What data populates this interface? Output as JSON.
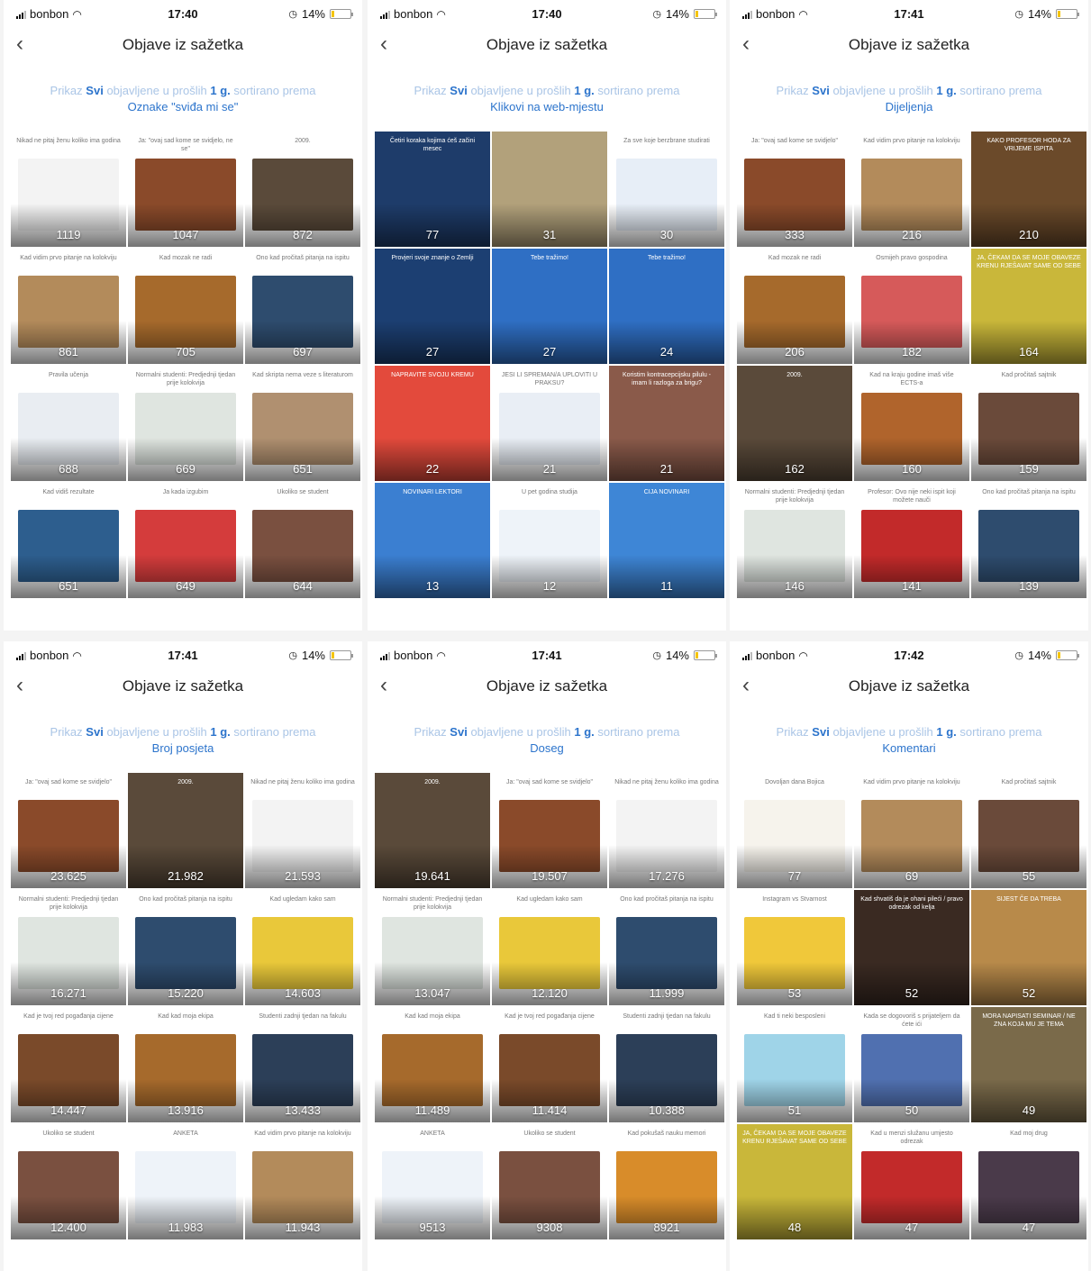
{
  "common": {
    "carrier": "bonbon",
    "battery": "14%",
    "title": "Objave iz sažetka",
    "back_icon": "chevron-left-icon",
    "subtitle_prefix": "Prikaz",
    "subtitle_type": "Svi",
    "subtitle_mid": "objavljene u prošlih",
    "subtitle_period": "1 g.",
    "subtitle_suffix": "sortirano prema"
  },
  "panels": [
    {
      "time": "17:40",
      "metric": "Oznake \"sviđa mi se\"",
      "tiles": [
        {
          "count": "1119",
          "color": "#f3f3f3",
          "caption": "Nikad ne pitaj ženu koliko ima godina"
        },
        {
          "count": "1047",
          "color": "#8a4a2a",
          "caption": "Ja: \"ovaj sad kome se svidjelo, ne se\""
        },
        {
          "count": "872",
          "color": "#5a4a3a",
          "caption": "2009."
        },
        {
          "count": "861",
          "color": "#b38b5b",
          "caption": "Kad vidim prvo pitanje na kolokviju"
        },
        {
          "count": "705",
          "color": "#a66a2c",
          "caption": "Kad mozak ne radi"
        },
        {
          "count": "697",
          "color": "#2e4c6e",
          "caption": "Ono kad pročitaš pitanja na ispitu"
        },
        {
          "count": "688",
          "color": "#e9edf2",
          "caption": "Pravila učenja"
        },
        {
          "count": "669",
          "color": "#dfe5e0",
          "caption": "Normalni studenti: Predjednji tjedan prije kolokvija"
        },
        {
          "count": "651",
          "color": "#b09070",
          "caption": "Kad skripta nema veze s literaturom"
        },
        {
          "count": "651",
          "color": "#2d5e8e",
          "caption": "Kad vidiš rezultate"
        },
        {
          "count": "649",
          "color": "#d43c3c",
          "caption": "Ja kada izgubim"
        },
        {
          "count": "644",
          "color": "#7a5040",
          "caption": "Ukoliko se student"
        }
      ]
    },
    {
      "time": "17:40",
      "metric": "Klikovi na web-mjestu",
      "tiles": [
        {
          "count": "77",
          "color": "#1e3c6a",
          "caption": "Četiri koraka kojima ćeš začini mesec",
          "full": true
        },
        {
          "count": "31",
          "color": "#b2a17b",
          "caption": "",
          "full": true
        },
        {
          "count": "30",
          "color": "#e7eef7",
          "caption": "Za sve koje berzbrane studirati"
        },
        {
          "count": "27",
          "color": "#1c3f72",
          "caption": "Provjeri svoje znanje o Zemlji",
          "full": true
        },
        {
          "count": "27",
          "color": "#2f6fc4",
          "caption": "Tebe tražimo!",
          "full": true
        },
        {
          "count": "24",
          "color": "#2f6fc4",
          "caption": "Tebe tražimo!",
          "full": true
        },
        {
          "count": "22",
          "color": "#e34a3c",
          "caption": "NAPRAVITE SVOJU KREMU",
          "full": true
        },
        {
          "count": "21",
          "color": "#e9eef5",
          "caption": "JESI LI SPREMAN/A UPLOVITI U PRAKSU?"
        },
        {
          "count": "21",
          "color": "#8a5a4a",
          "caption": "Koristim kontracepcijsku pilulu - imam li razloga za brigu?",
          "full": true
        },
        {
          "count": "13",
          "color": "#3b7fd1",
          "caption": "NOVINARI LEKTORI",
          "full": true
        },
        {
          "count": "12",
          "color": "#eef3f9",
          "caption": "U pet godina studija"
        },
        {
          "count": "11",
          "color": "#3e86d6",
          "caption": "CIJA NOVINARI",
          "full": true
        }
      ]
    },
    {
      "time": "17:41",
      "metric": "Dijeljenja",
      "tiles": [
        {
          "count": "333",
          "color": "#8a4a2a",
          "caption": "Ja: \"ovaj sad kome se svidjelo\""
        },
        {
          "count": "216",
          "color": "#b38b5b",
          "caption": "Kad vidim prvo pitanje na kolokviju"
        },
        {
          "count": "210",
          "color": "#6b4a2a",
          "caption": "KAKO PROFESOR HODA ZA VRIJEME ISPITA",
          "full": true
        },
        {
          "count": "206",
          "color": "#a66a2c",
          "caption": "Kad mozak ne radi"
        },
        {
          "count": "182",
          "color": "#d65a5a",
          "caption": "Osmijeh pravo gospodina"
        },
        {
          "count": "164",
          "color": "#c9b73a",
          "caption": "JA, ČEKAM DA SE MOJE OBAVEZE KRENU RJEŠAVAT SAME OD SEBE",
          "full": true
        },
        {
          "count": "162",
          "color": "#5a4a3a",
          "caption": "2009.",
          "full": true
        },
        {
          "count": "160",
          "color": "#b0642c",
          "caption": "Kad na kraju godine imaš više ECTS-a"
        },
        {
          "count": "159",
          "color": "#6a4a3a",
          "caption": "Kad pročitaš sajtnik"
        },
        {
          "count": "146",
          "color": "#dfe5e0",
          "caption": "Normalni studenti: Predjednji tjedan prije kolokvija"
        },
        {
          "count": "141",
          "color": "#c22a2a",
          "caption": "Profesor: Ovo nije neki ispit koji možete nauči"
        },
        {
          "count": "139",
          "color": "#2e4c6e",
          "caption": "Ono kad pročitaš pitanja na ispitu"
        }
      ]
    },
    {
      "time": "17:41",
      "metric": "Broj posjeta",
      "tiles": [
        {
          "count": "23.625",
          "color": "#8a4a2a",
          "caption": "Ja: \"ovaj sad kome se svidjelo\""
        },
        {
          "count": "21.982",
          "color": "#5a4a3a",
          "caption": "2009.",
          "full": true
        },
        {
          "count": "21.593",
          "color": "#f3f3f3",
          "caption": "Nikad ne pitaj ženu koliko ima godina"
        },
        {
          "count": "16.271",
          "color": "#dfe5e0",
          "caption": "Normalni studenti: Predjednji tjedan prije kolokvija"
        },
        {
          "count": "15.220",
          "color": "#2e4c6e",
          "caption": "Ono kad pročitaš pitanja na ispitu"
        },
        {
          "count": "14.603",
          "color": "#e9c83a",
          "caption": "Kad ugledam kako sam"
        },
        {
          "count": "14.447",
          "color": "#7a4a2a",
          "caption": "Kad je tvoj red pogađanja cijene"
        },
        {
          "count": "13.916",
          "color": "#a66a2c",
          "caption": "Kad kad moja ekipa"
        },
        {
          "count": "13.433",
          "color": "#2c3f58",
          "caption": "Studenti zadnji tjedan na fakulu"
        },
        {
          "count": "12.400",
          "color": "#7a5040",
          "caption": "Ukoliko se student"
        },
        {
          "count": "11.983",
          "color": "#eef3f9",
          "caption": "ANKETA"
        },
        {
          "count": "11.943",
          "color": "#b38b5b",
          "caption": "Kad vidim prvo pitanje na kolokviju"
        }
      ]
    },
    {
      "time": "17:41",
      "metric": "Doseg",
      "tiles": [
        {
          "count": "19.641",
          "color": "#5a4a3a",
          "caption": "2009.",
          "full": true
        },
        {
          "count": "19.507",
          "color": "#8a4a2a",
          "caption": "Ja: \"ovaj sad kome se svidjelo\""
        },
        {
          "count": "17.276",
          "color": "#f3f3f3",
          "caption": "Nikad ne pitaj ženu koliko ima godina"
        },
        {
          "count": "13.047",
          "color": "#dfe5e0",
          "caption": "Normalni studenti: Predjednji tjedan prije kolokvija"
        },
        {
          "count": "12.120",
          "color": "#e9c83a",
          "caption": "Kad ugledam kako sam"
        },
        {
          "count": "11.999",
          "color": "#2e4c6e",
          "caption": "Ono kad pročitaš pitanja na ispitu"
        },
        {
          "count": "11.489",
          "color": "#a66a2c",
          "caption": "Kad kad moja ekipa"
        },
        {
          "count": "11.414",
          "color": "#7a4a2a",
          "caption": "Kad je tvoj red pogađanja cijene"
        },
        {
          "count": "10.388",
          "color": "#2c3f58",
          "caption": "Studenti zadnji tjedan na fakulu"
        },
        {
          "count": "9513",
          "color": "#eef3f9",
          "caption": "ANKETA"
        },
        {
          "count": "9308",
          "color": "#7a5040",
          "caption": "Ukoliko se student"
        },
        {
          "count": "8921",
          "color": "#d88c2a",
          "caption": "Kad pokušaš nauku memori"
        }
      ]
    },
    {
      "time": "17:42",
      "metric": "Komentari",
      "tiles": [
        {
          "count": "77",
          "color": "#f6f3ec",
          "caption": "Dovoljan dana Bojica"
        },
        {
          "count": "69",
          "color": "#b38b5b",
          "caption": "Kad vidim prvo pitanje na kolokviju"
        },
        {
          "count": "55",
          "color": "#6a4a3a",
          "caption": "Kad pročitaš sajtnik"
        },
        {
          "count": "53",
          "color": "#f0c83a",
          "caption": "Instagram vs Stvarnost"
        },
        {
          "count": "52",
          "color": "#3a2a22",
          "caption": "Kad shvatiš da je ohani pileći / pravo odrezak od kelja",
          "full": true
        },
        {
          "count": "52",
          "color": "#b88a4a",
          "caption": "SIJEST ČE DA TREBA",
          "full": true
        },
        {
          "count": "51",
          "color": "#9fd4e8",
          "caption": "Kad ti neki besposleni"
        },
        {
          "count": "50",
          "color": "#5070b0",
          "caption": "Kada se dogovoriš s prijateljem da ćete ići"
        },
        {
          "count": "49",
          "color": "#7a6a4a",
          "caption": "MORA NAPISATI SEMINAR / NE ZNA KOJA MU JE TEMA",
          "full": true
        },
        {
          "count": "48",
          "color": "#c9b73a",
          "caption": "JA, ČEKAM DA SE MOJE OBAVEZE KRENU RJEŠAVAT SAME OD SEBE",
          "full": true
        },
        {
          "count": "47",
          "color": "#c22a2a",
          "caption": "Kad u menzi služanu umjesto odrezak"
        },
        {
          "count": "47",
          "color": "#4a3a4a",
          "caption": "Kad moj drug"
        }
      ]
    }
  ]
}
